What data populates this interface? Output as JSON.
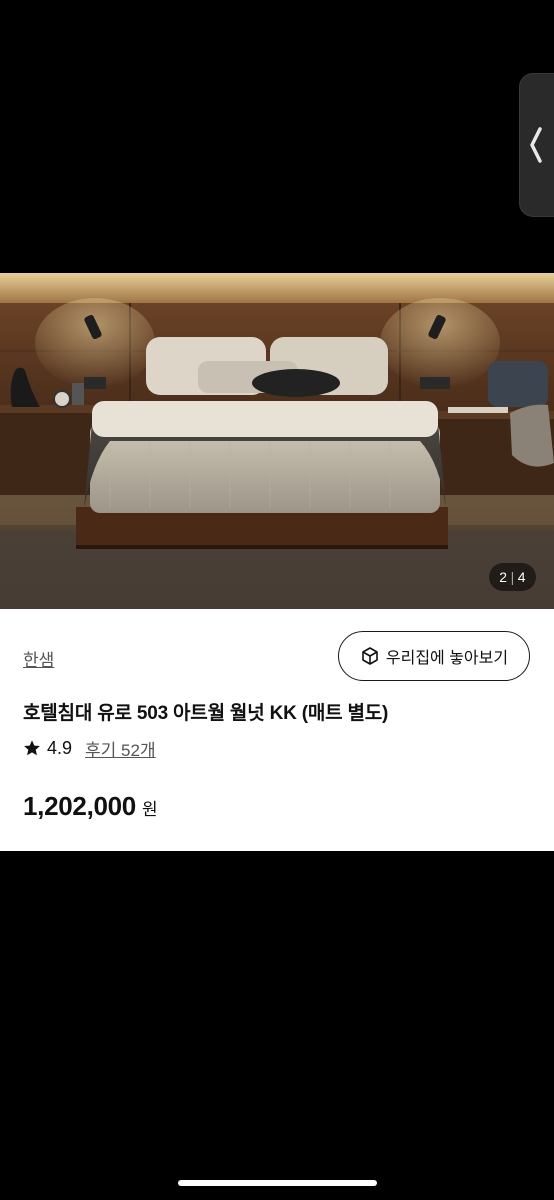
{
  "image": {
    "page_current": "2",
    "page_total": "4"
  },
  "product": {
    "brand": "한샘",
    "ar_button_label": "우리집에 놓아보기",
    "title": "호텔침대 유로 503 아트월 월넛 KK (매트 별도)",
    "rating": "4.9",
    "reviews_label": "후기 52개",
    "price": "1,202,000",
    "currency": "원"
  },
  "icons": {
    "side_handle": "chevron-left-icon",
    "ar": "ar-cube-icon",
    "rating": "star-icon"
  },
  "colors": {
    "background": "#000000",
    "panel": "#ffffff",
    "text_primary": "#111111",
    "text_secondary": "#555555"
  }
}
